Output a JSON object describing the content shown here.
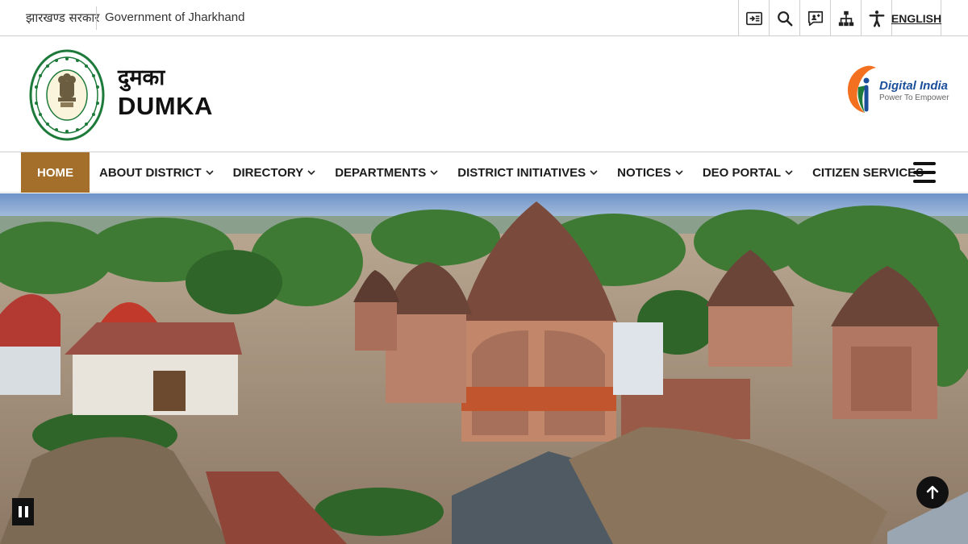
{
  "topbar": {
    "gov_hindi": "झारखण्ड सरकार",
    "gov_english": "Government of Jharkhand",
    "tools": [
      {
        "icon": "skip-to-content-icon"
      },
      {
        "icon": "search-icon"
      },
      {
        "icon": "feedback-icon"
      },
      {
        "icon": "sitemap-icon"
      },
      {
        "icon": "accessibility-icon"
      }
    ],
    "language": "ENGLISH"
  },
  "header": {
    "title_hindi": "दुमका",
    "title_english": "DUMKA",
    "emblem_icon": "jharkhand-government-seal",
    "digital_india": {
      "name": "Digital India",
      "tagline": "Power To Empower"
    }
  },
  "nav": {
    "items": [
      {
        "label": "HOME",
        "active": true,
        "dropdown": false
      },
      {
        "label": "ABOUT DISTRICT",
        "active": false,
        "dropdown": true
      },
      {
        "label": "DIRECTORY",
        "active": false,
        "dropdown": true
      },
      {
        "label": "DEPARTMENTS",
        "active": false,
        "dropdown": true
      },
      {
        "label": "DISTRICT INITIATIVES",
        "active": false,
        "dropdown": true
      },
      {
        "label": "NOTICES",
        "active": false,
        "dropdown": true
      },
      {
        "label": "DEO PORTAL",
        "active": false,
        "dropdown": true
      },
      {
        "label": "CITIZEN SERVICES",
        "active": false,
        "dropdown": false
      }
    ],
    "menu_icon": "hamburger-icon"
  },
  "hero": {
    "scene": "terracotta temples village photo",
    "controls": {
      "pause_icon": "pause-icon",
      "scroll_top_icon": "arrow-up-icon"
    }
  },
  "colors": {
    "accent": "#a46f2b",
    "digital_india_blue": "#1b4f9c"
  }
}
